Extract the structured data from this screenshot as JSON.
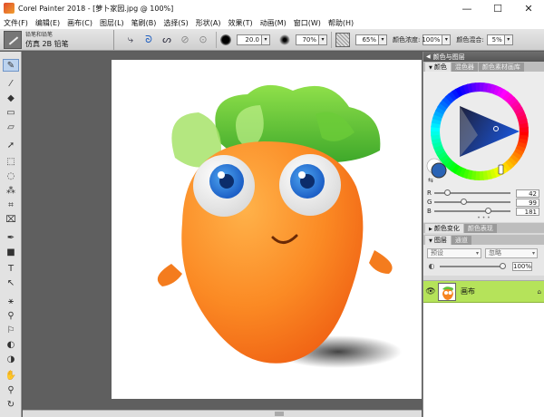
{
  "window": {
    "title": "Corel Painter 2018 - [萝卜家园.jpg @ 100%]",
    "controls": [
      "—",
      "☐",
      "✕"
    ]
  },
  "menu": [
    "文件(F)",
    "编辑(E)",
    "画布(C)",
    "图层(L)",
    "笔刷(B)",
    "选择(S)",
    "形状(A)",
    "效果(T)",
    "动画(M)",
    "窗口(W)",
    "帮助(H)"
  ],
  "property_bar": {
    "brush_category": "铅笔和铅笔",
    "brush_variant": "仿真 2B 铅笔",
    "size_value": "20.0",
    "opacity_value": "70%",
    "grain_value": "65%",
    "color_density_label": "颜色浓度:",
    "color_density_value": "100%",
    "color_mix_label": "颜色混合:",
    "color_mix_value": "5%"
  },
  "panels": {
    "color_panel_title": "颜色与图层",
    "color_tabs": [
      "颜色",
      "混色器",
      "颜色素材画库"
    ],
    "rgb": {
      "r_label": "R",
      "r": "42",
      "g_label": "G",
      "g": "99",
      "b_label": "B",
      "b": "181"
    },
    "current_color": "#2a63b5",
    "variability_title": "颜色变化",
    "variability_tab2": "颜色表现",
    "layer_tabs": [
      "图层",
      "通道"
    ],
    "composite_method": "预设",
    "composite_depth": "忽略",
    "layer_opacity": "100%",
    "layer_name": "画布"
  }
}
